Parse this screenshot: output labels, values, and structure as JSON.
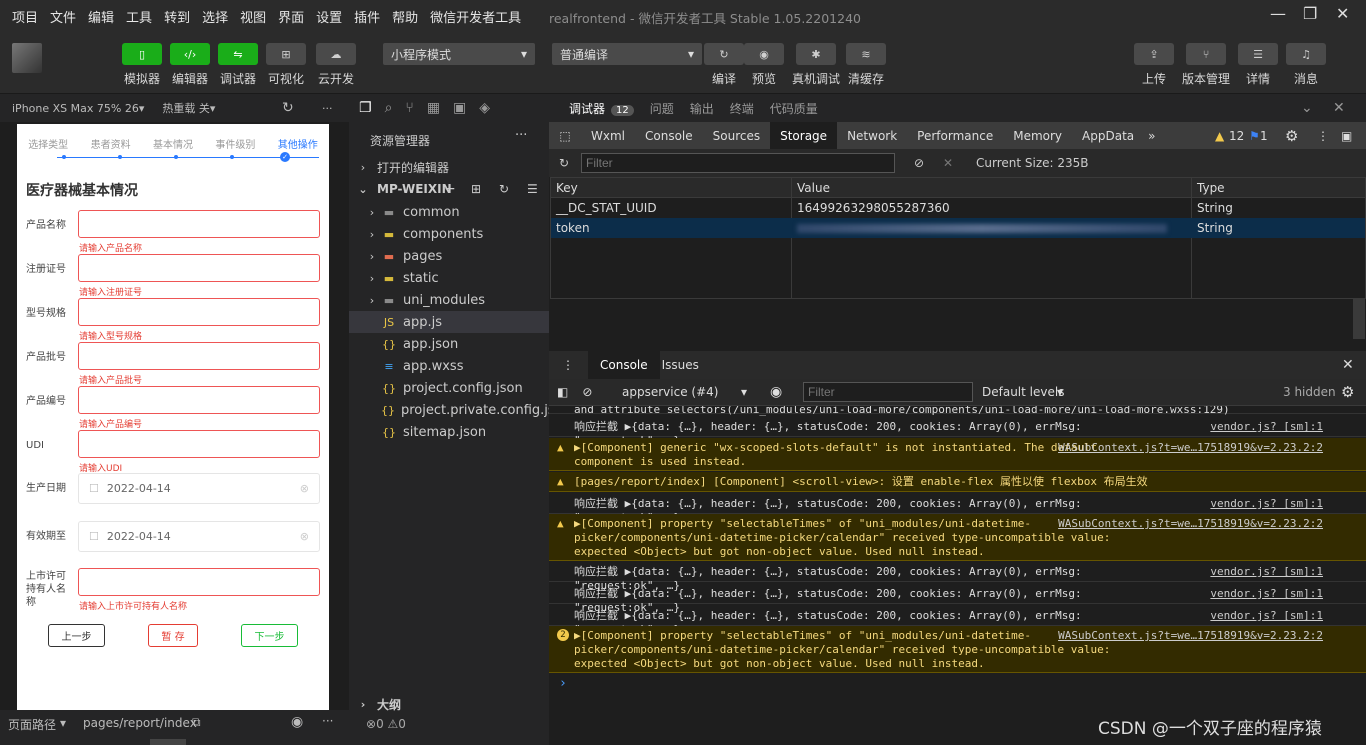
{
  "menu": [
    "项目",
    "文件",
    "编辑",
    "工具",
    "转到",
    "选择",
    "视图",
    "界面",
    "设置",
    "插件",
    "帮助",
    "微信开发者工具"
  ],
  "window_title": "realfrontend",
  "window_subtitle": "- 微信开发者工具 Stable 1.05.2201240",
  "toolbar": {
    "left": [
      {
        "label": "模拟器",
        "icon": "phone-icon",
        "style": "green"
      },
      {
        "label": "编辑器",
        "icon": "code-icon",
        "style": "green"
      },
      {
        "label": "调试器",
        "icon": "debug-icon",
        "style": "green"
      },
      {
        "label": "可视化",
        "icon": "layout-icon",
        "style": "gray"
      },
      {
        "label": "云开发",
        "icon": "cloud-icon",
        "style": "gray"
      }
    ],
    "mode_select": "小程序模式",
    "compile_select": "普通编译",
    "mid": [
      {
        "label": "编译",
        "icon": "refresh-icon"
      },
      {
        "label": "预览",
        "icon": "eye-icon"
      },
      {
        "label": "真机调试",
        "icon": "bug-icon"
      },
      {
        "label": "清缓存",
        "icon": "layers-icon"
      }
    ],
    "right": [
      {
        "label": "上传",
        "icon": "upload-icon"
      },
      {
        "label": "版本管理",
        "icon": "branch-icon"
      },
      {
        "label": "详情",
        "icon": "menu-icon"
      },
      {
        "label": "消息",
        "icon": "bell-icon"
      }
    ]
  },
  "simulator": {
    "device": "iPhone XS Max 75% 26",
    "hot_reload": "热重载 关",
    "steps": [
      "选择类型",
      "患者资料",
      "基本情况",
      "事件级别",
      "其他操作"
    ],
    "form_title": "医疗器械基本情况",
    "fields": [
      {
        "label": "产品名称",
        "error": "请输入产品名称"
      },
      {
        "label": "注册证号",
        "error": "请输入注册证号"
      },
      {
        "label": "型号规格",
        "error": "请输入型号规格"
      },
      {
        "label": "产品批号",
        "error": "请输入产品批号"
      },
      {
        "label": "产品编号",
        "error": "请输入产品编号"
      },
      {
        "label": "UDI",
        "error": "请输入UDI"
      }
    ],
    "date_fields": [
      {
        "label": "生产日期",
        "value": "2022-04-14"
      },
      {
        "label": "有效期至",
        "value": "2022-04-14"
      }
    ],
    "license_field": {
      "label": "上市许可持有人名称",
      "error": "请输入上市许可持有人名称"
    },
    "buttons": {
      "prev": "上一步",
      "save": "暂 存",
      "next": "下一步"
    },
    "footer_path_label": "页面路径",
    "footer_path": "pages/report/index"
  },
  "explorer": {
    "title": "资源管理器",
    "open_editors": "打开的编辑器",
    "project": "MP-WEIXIN",
    "items": [
      {
        "name": "common",
        "type": "folder",
        "color": "#8a8a8a"
      },
      {
        "name": "components",
        "type": "folder",
        "color": "#d5b93b"
      },
      {
        "name": "pages",
        "type": "folder",
        "color": "#e06c4f"
      },
      {
        "name": "static",
        "type": "folder",
        "color": "#d5b93b"
      },
      {
        "name": "uni_modules",
        "type": "folder",
        "color": "#8a8a8a"
      },
      {
        "name": "app.js",
        "type": "js",
        "color": "#e8c547"
      },
      {
        "name": "app.json",
        "type": "json",
        "color": "#e8c547"
      },
      {
        "name": "app.wxss",
        "type": "wxss",
        "color": "#42a5f5"
      },
      {
        "name": "project.config.json",
        "type": "json",
        "color": "#e8c547"
      },
      {
        "name": "project.private.config.js...",
        "type": "json",
        "color": "#e8c547"
      },
      {
        "name": "sitemap.json",
        "type": "json",
        "color": "#e8c547"
      }
    ],
    "outline": "大纲",
    "status_errors": "0",
    "status_warnings": "0"
  },
  "devtools": {
    "top_tabs": [
      "调试器",
      "问题",
      "输出",
      "终端",
      "代码质量"
    ],
    "debugger_badge": "12",
    "tabs": [
      "Wxml",
      "Console",
      "Sources",
      "Storage",
      "Network",
      "Performance",
      "Memory",
      "AppData"
    ],
    "active_tab": "Storage",
    "warn_count": "12",
    "error_count": "1",
    "filter_placeholder": "Filter",
    "current_size": "Current Size: 235B",
    "storage_headers": [
      "Key",
      "Value",
      "Type"
    ],
    "storage_rows": [
      {
        "key": "__DC_STAT_UUID",
        "value": "16499263298055287360",
        "type": "String"
      },
      {
        "key": "token",
        "value": "",
        "type": "String"
      }
    ]
  },
  "console_panel": {
    "tabs": [
      "Console",
      "Issues"
    ],
    "context": "appservice (#4)",
    "filter_placeholder": "Filter",
    "levels": "Default levels",
    "hidden": "3 hidden",
    "prompt": "›",
    "lines": [
      {
        "kind": "log",
        "text": "and attribute selectors(/uni_modules/uni-load-more/components/uni-load-more/uni-load-more.wxss:129)",
        "src": ""
      },
      {
        "kind": "log",
        "text": "响应拦截 ▶{data: {…}, header: {…}, statusCode: 200, cookies: Array(0), errMsg: \"request:ok\", …}",
        "src": "vendor.js? [sm]:1"
      },
      {
        "kind": "warn",
        "text": "▶[Component] generic \"wx-scoped-slots-default\" is not instantiated. The default component is used instead.",
        "src": "WASubContext.js?t=we…17518919&v=2.23.2:2"
      },
      {
        "kind": "warn",
        "text": "[pages/report/index] [Component] <scroll-view>: 设置 enable-flex 属性以使 flexbox 布局生效",
        "src": ""
      },
      {
        "kind": "log",
        "text": "响应拦截 ▶{data: {…}, header: {…}, statusCode: 200, cookies: Array(0), errMsg: \"request:ok\", …}",
        "src": "vendor.js? [sm]:1"
      },
      {
        "kind": "warn",
        "text": "▶[Component] property \"selectableTimes\" of \"uni_modules/uni-datetime-picker/components/uni-datetime-picker/calendar\" received type-uncompatible value: expected <Object> but got non-object value. Used null instead.",
        "src": "WASubContext.js?t=we…17518919&v=2.23.2:2"
      },
      {
        "kind": "log",
        "text": "响应拦截 ▶{data: {…}, header: {…}, statusCode: 200, cookies: Array(0), errMsg: \"request:ok\", …}",
        "src": "vendor.js? [sm]:1"
      },
      {
        "kind": "log",
        "text": "响应拦截 ▶{data: {…}, header: {…}, statusCode: 200, cookies: Array(0), errMsg: \"request:ok\", …}",
        "src": "vendor.js? [sm]:1"
      },
      {
        "kind": "log",
        "text": "响应拦截 ▶{data: {…}, header: {…}, statusCode: 200, cookies: Array(0), errMsg: \"request:ok\", …}",
        "src": "vendor.js? [sm]:1"
      },
      {
        "kind": "warn",
        "badge": "2",
        "text": "▶[Component] property \"selectableTimes\" of \"uni_modules/uni-datetime-picker/components/uni-datetime-picker/calendar\" received type-uncompatible value: expected <Object> but got non-object value. Used null instead.",
        "src": "WASubContext.js?t=we…17518919&v=2.23.2:2"
      }
    ]
  },
  "watermark": "CSDN @一个双子座的程序猿"
}
